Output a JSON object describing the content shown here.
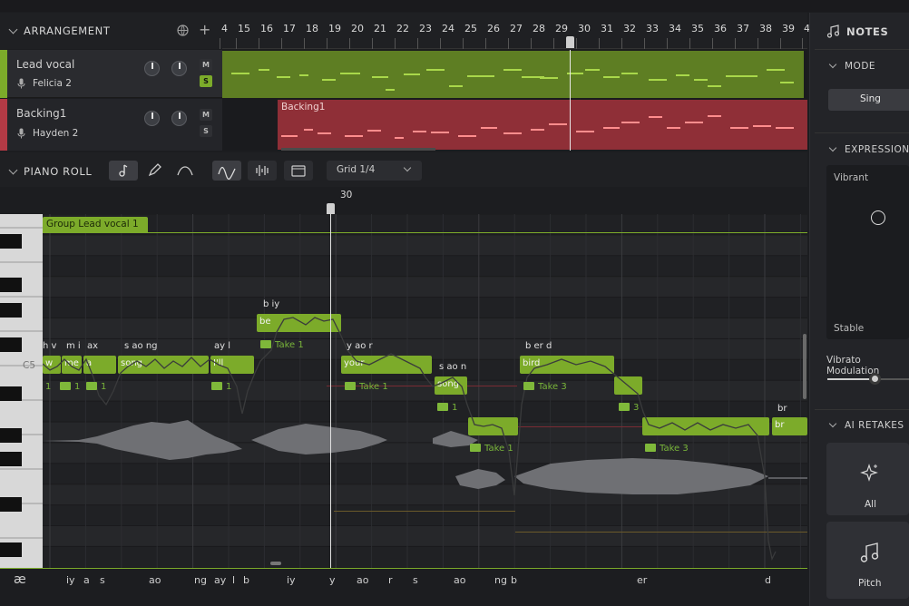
{
  "arrangement": {
    "header": "ARRANGEMENT",
    "ruler": [
      "4",
      "15",
      "16",
      "17",
      "18",
      "19",
      "20",
      "21",
      "22",
      "23",
      "24",
      "25",
      "26",
      "27",
      "28",
      "29",
      "30",
      "31",
      "32",
      "33",
      "34",
      "35",
      "36",
      "37",
      "38",
      "39",
      "4"
    ],
    "tracks": [
      {
        "name": "Lead vocal",
        "singer": "Felicia 2",
        "mute": "M",
        "solo": "S",
        "color": "#7cab2a"
      },
      {
        "name": "Backing1",
        "singer": "Hayden 2",
        "mute": "M",
        "solo": "S",
        "color": "#b33a45",
        "clip_label": "Backing1"
      }
    ]
  },
  "piano_roll": {
    "header": "PIANO ROLL",
    "grid_select": "Grid 1/4",
    "playhead_label": "30",
    "group_label": "Group Lead vocal 1",
    "key_label": "C5",
    "notes": [
      {
        "text": "w"
      },
      {
        "text": "me"
      },
      {
        "text": "a"
      },
      {
        "text": "song"
      },
      {
        "text": "I'll"
      },
      {
        "text": "be"
      },
      {
        "text": "your"
      },
      {
        "text": "song"
      },
      {
        "text": ""
      },
      {
        "text": "bird"
      },
      {
        "text": ""
      },
      {
        "text": ""
      },
      {
        "text": "br"
      }
    ],
    "phoneme_labels": [
      "h v",
      "m i",
      "ax",
      "s ao ng",
      "ay l",
      "b iy",
      "y ao r",
      "s ao n",
      "b er d",
      "br"
    ],
    "tags": [
      "1",
      "1",
      "1",
      "1",
      "Take 1",
      "Take 1",
      "1",
      "Take 1",
      "Take 3",
      "3",
      "Take 3"
    ],
    "phoneme_row_icon": "æ",
    "phonemes": [
      "iy",
      "a",
      "s",
      "ao",
      "ng",
      "ay",
      "l",
      "b",
      "iy",
      "y",
      "ao",
      "r",
      "s",
      "ao",
      "ng",
      "b",
      "er",
      "d"
    ]
  },
  "sidebar": {
    "notes_header": "NOTES",
    "mode_header": "MODE",
    "mode_value": "Sing",
    "expression_header": "EXPRESSION",
    "expr_top": "Vibrant",
    "expr_bottom": "Stable",
    "vibrato_label": "Vibrato Modulation",
    "vibrato_value": 0.58,
    "retakes_header": "AI RETAKES",
    "retake_all": "All",
    "retake_pitch": "Pitch"
  },
  "colors": {
    "green": "#7cab2a",
    "red": "#b33a45",
    "bg": "#1c1d20"
  }
}
